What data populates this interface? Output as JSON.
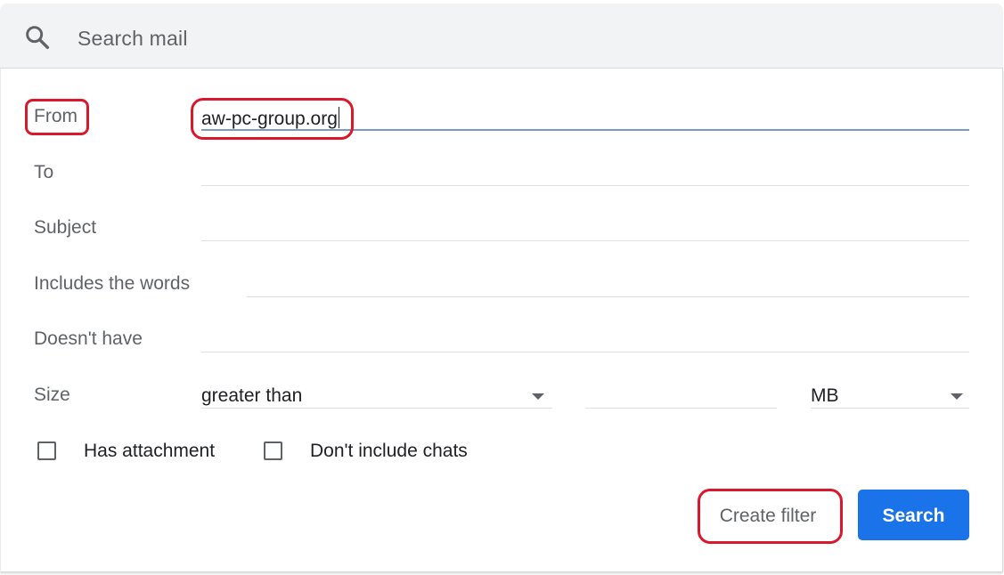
{
  "search": {
    "placeholder": "Search mail"
  },
  "fields": {
    "from": {
      "label": "From",
      "value": "aw-pc-group.org"
    },
    "to": {
      "label": "To",
      "value": ""
    },
    "subject": {
      "label": "Subject",
      "value": ""
    },
    "includes": {
      "label": "Includes the words",
      "value": ""
    },
    "doesnt_have": {
      "label": "Doesn't have",
      "value": ""
    }
  },
  "size": {
    "label": "Size",
    "comparator": "greater than",
    "amount": "",
    "unit": "MB"
  },
  "checkboxes": {
    "has_attachment": {
      "label": "Has attachment",
      "checked": false
    },
    "dont_include_chats": {
      "label": "Don't include chats",
      "checked": false
    }
  },
  "buttons": {
    "create_filter": "Create filter",
    "search": "Search"
  },
  "colors": {
    "primary": "#1a73e8",
    "annotation": "#d9182b",
    "header_bg": "#f1f3f4"
  },
  "icons": {
    "search": "search-icon",
    "dropdown": "arrow-drop-down-icon",
    "checkbox": "checkbox-unchecked-icon"
  }
}
